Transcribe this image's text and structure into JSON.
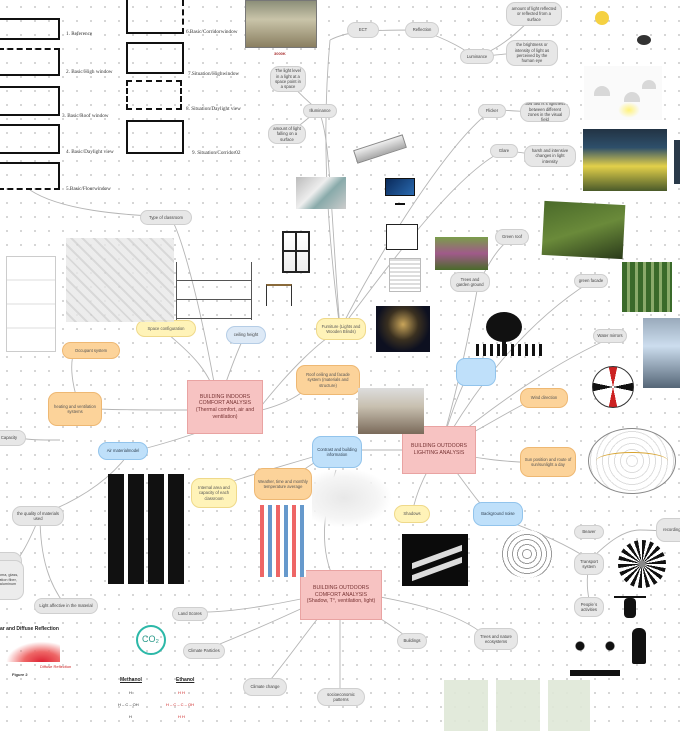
{
  "nodes": {
    "ect": "ECT",
    "reflection": "Reflection",
    "amount_of_light_reflected": "amount of light reflected or reflected from a surface",
    "luminance": "Luminance",
    "brightness_intensity": "the brightness or intensity of light as perceived by the human eye",
    "light_level": "The light level in a light at a space point in a space",
    "illuminance": "Illuminance",
    "amount_light_falling": "amount of light falling on a surface",
    "flicker": "Flicker",
    "flicker_desc": "how fast is it lightness between different zones in the visual field",
    "glare": "Glare",
    "glare_desc": "harsh and intensive changes in light intensity",
    "green_roof": "Green roof",
    "trees_garden": "Trees and garden ground",
    "green_facade": "green facade",
    "water_mirrors": "Water mirrors",
    "wind_direction": "Wind direction",
    "sun_position": "Sun position and route of sun/sunlight a day",
    "type_of_classroom": "Type of classroom",
    "space_configuration": "Space configuration",
    "ceiling_height": "ceiling height",
    "furniture_lights": "Furniture (Lights and Wooden Blinds)",
    "roof_ceiling_facade": "Roof ceiling and facade system (materials and structure)",
    "occupant_system": "Occupant system",
    "heating_ventilation": "heating and ventilation systems",
    "indoors_comfort": "BUILDING INDOORS COMFORT ANALYSIS (Thermal comfort, air and ventilation)",
    "capacity": "Capacity",
    "air_materialsmodel": "Air materialmodel",
    "contrast_building": "Contrast and building information",
    "outdoors_lighting": "BUILDING OUTDOORS LIGHTING ANALYSIS",
    "internal_area": "Internal area and capacity of each classroom",
    "weather_time": "Weather, time and monthly temperature average",
    "shadows": "Shadows",
    "background_noise": "Background noise",
    "quality_of_materials": "the quality of materials used",
    "atmosphere": "Atmosphere",
    "beaver": "Beaver",
    "recording": "recording t",
    "transport_system": "Transport system",
    "peoples_activities": "People´s activities",
    "light_affective": "Light affective in the material",
    "roma_glass": "roma, glass, ation fiber, aluminum",
    "outdoors_comfort": "BUILDING OUTDOORS COMFORT ANALYSIS (Shadow, T°, ventilation, light)",
    "land_scores": "Land Scores",
    "climate_particles": "Climate Particles",
    "buildings": "Buildings",
    "trees_ecosystems": "Trees and nature ecosystems",
    "climate_change": "Climate change",
    "socioeconomic": "socioeconomic patterns"
  },
  "captions": {
    "reference": "1. Reference",
    "high_window": "2. Basic/High window",
    "roof_window": "3. Basic/Roof window",
    "daylight_view": "4. Basic/Daylight view",
    "floor_window": "5.Basic/Floorwindow",
    "corridor_window": "6.Basic/Corridorwindow",
    "situation_high": "7.Situation/Highwindow",
    "situation_daylight": "8. Situation/Daylight view",
    "situation_corridor": "9. Situation/Corridor02",
    "photo_3000k": "3000K"
  },
  "labels": {
    "diffuse_title": "ar and Diffuse Reflection",
    "diffuse_reflection": "Diffuse Reflection",
    "figure": "Figure 2",
    "co2": "CO₂",
    "methanol": "Methanol",
    "ethanol": "Ethanol",
    "methanol_formula": "H – C – OH",
    "ethanol_formula": "H – C – C – OH",
    "h_top": "H",
    "h_top2": "H   H",
    "h_bottom": "H",
    "h_bottom2": "H   H"
  },
  "colors": {
    "yellow": "#fff3b8",
    "orange": "#fcd39a",
    "blue": "#bfe0fa",
    "pink": "#f7c3c2",
    "grey": "#e7e7e7"
  }
}
